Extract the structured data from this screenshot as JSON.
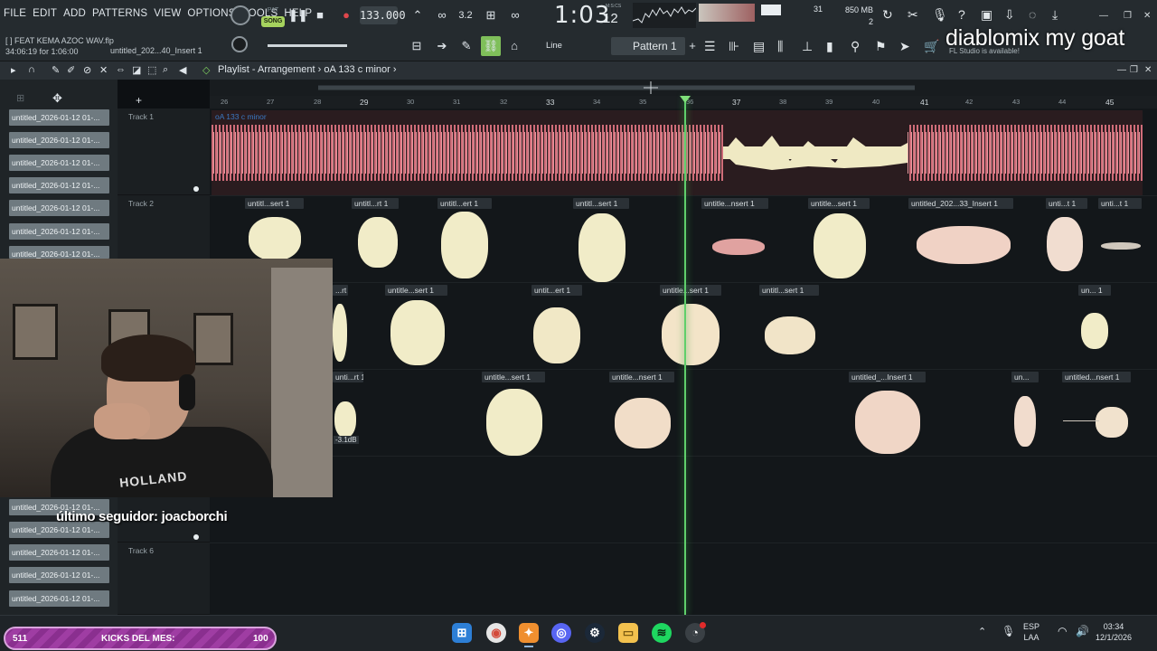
{
  "menu": [
    "FILE",
    "EDIT",
    "ADD",
    "PATTERNS",
    "VIEW",
    "OPTIONS",
    "TOOLS",
    "HELP"
  ],
  "transport": {
    "pat_label": "PAT",
    "song_label": "SONG",
    "tempo": "133.000",
    "time": "1:03",
    "time_frac": "12",
    "time_label": "M:S:CS",
    "time_sig": "3.2",
    "cpu": "31",
    "memory": "850 MB",
    "memory_sub": "2"
  },
  "project": {
    "position_line": "34:06:19 for 1:06:00",
    "file_name": "[ ] FEAT KEMA AZOC WAV.flp",
    "selected_clip": "untitled_202...40_Insert 1"
  },
  "toolbar": {
    "snap": "Line",
    "pattern": "Pattern 1",
    "hint": "FL Studio is available!"
  },
  "overlay": {
    "title": "diablomix my goat",
    "follower": "último seguidor: joacborchi"
  },
  "playlist": {
    "title": "Playlist - Arrangement",
    "breadcrumb": "oA 133 c minor",
    "ruler": [
      "26",
      "27",
      "28",
      "29",
      "30",
      "31",
      "32",
      "33",
      "34",
      "35",
      "36",
      "37",
      "38",
      "39",
      "40",
      "41",
      "42",
      "43",
      "44",
      "45"
    ],
    "tracks": [
      "Track 1",
      "Track 2",
      "Track 6"
    ],
    "track1_clip": "oA 133 c minor",
    "gain_label": "-3.1dB"
  },
  "browser_items": [
    "untitled_2026-01-12 01-...",
    "untitled_2026-01-12 01-...",
    "untitled_2026-01-12 01-...",
    "untitled_2026-01-12 01-...",
    "untitled_2026-01-12 01-...",
    "untitled_2026-01-12 01-...",
    "untitled_2026-01-12 01-...",
    "untitled_2026-01-12 01-...",
    "untitled_2026-01-12 01-...",
    "untitled_2026-01-12 01-...",
    "untitled_2026-01-12 01-...",
    "untitled_2026-01-12 01-..."
  ],
  "clips": {
    "row2": [
      "untitl...sert 1",
      "untitl...rt 1",
      "untitl...ert 1",
      "untitl...sert 1",
      "untitle...nsert 1",
      "untitle...sert 1",
      "untitled_202...33_Insert 1",
      "unti...t 1",
      "unti...t 1"
    ],
    "row3": [
      "...rt 1",
      "untitle...sert 1",
      "untit...ert 1",
      "untitle...sert 1",
      "untitl...sert 1",
      "un... 1"
    ],
    "row4": [
      "unti...rt 1",
      "untitle...sert 1",
      "untitle...nsert 1",
      "untitled_...Insert 1",
      "un...",
      "untitled...nsert 1"
    ]
  },
  "kicks": {
    "left": "511",
    "label": "KICKS DEL MES:",
    "right": "100"
  },
  "tray": {
    "lang": "ESP",
    "layout": "LAA",
    "time": "03:34",
    "date": "12/1/2026"
  },
  "colors": {
    "waveform_pink": "#d4707a",
    "waveform_cream": "#f1ecc8",
    "playhead": "#5fcf6b",
    "song_mode": "#a6d35e"
  }
}
